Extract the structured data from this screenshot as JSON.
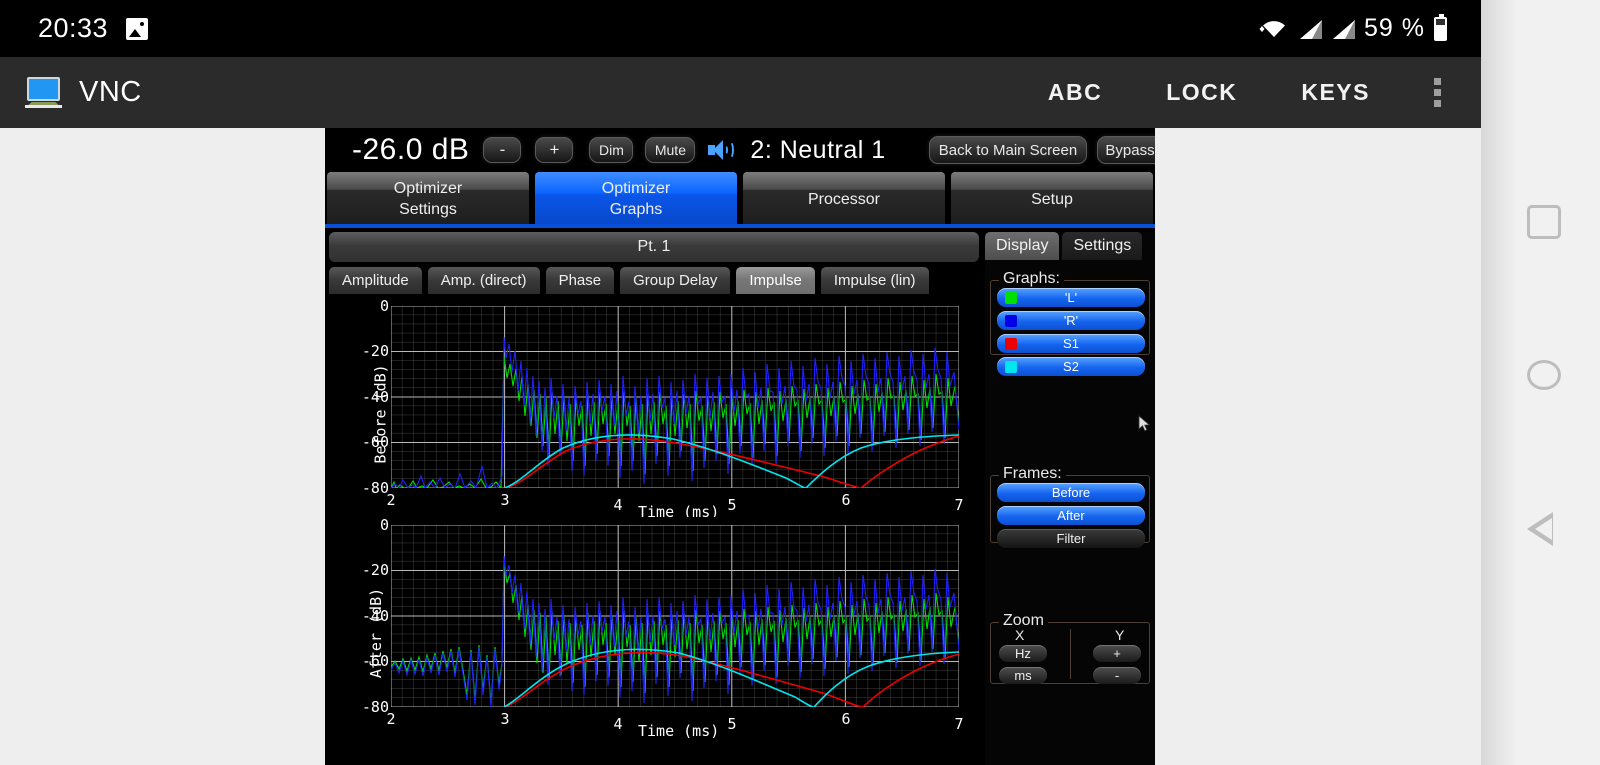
{
  "status_bar": {
    "clock": "20:33",
    "photo_icon": "image-icon",
    "wifi_icon": "wifi-icon",
    "signal_icon_1": "cell-signal-icon",
    "signal_icon_2": "cell-signal-icon",
    "battery_percent": "59 %",
    "battery_icon": "battery-icon"
  },
  "app_bar": {
    "icon": "vnc-monitor-icon",
    "title": "VNC",
    "buttons": [
      {
        "label": "ABC",
        "name": "abc-button"
      },
      {
        "label": "LOCK",
        "name": "lock-button"
      },
      {
        "label": "KEYS",
        "name": "keys-button"
      }
    ],
    "overflow_icon": "kebab-menu-icon"
  },
  "remote": {
    "control_strip": {
      "db_readout": "-26.0 dB",
      "minus": "-",
      "plus": "+",
      "dim": "Dim",
      "mute": "Mute",
      "speaker_icon": "speaker-volume-icon",
      "preset": "2: Neutral  1",
      "back_to_main": "Back to Main Screen",
      "bypass": "Bypass"
    },
    "main_tabs": [
      {
        "line1": "Optimizer",
        "line2": "Settings",
        "active": false
      },
      {
        "line1": "Optimizer",
        "line2": "Graphs",
        "active": true
      },
      {
        "line1": "Processor",
        "line2": "",
        "active": false
      },
      {
        "line1": "Setup",
        "line2": "",
        "active": false
      }
    ],
    "point_bar": "Pt. 1",
    "graph_tabs": [
      {
        "label": "Amplitude",
        "active": false
      },
      {
        "label": "Amp. (direct)",
        "active": false
      },
      {
        "label": "Phase",
        "active": false
      },
      {
        "label": "Group Delay",
        "active": false
      },
      {
        "label": "Impulse",
        "active": true
      },
      {
        "label": "Impulse (lin)",
        "active": false
      }
    ],
    "side_panel": {
      "tabs": [
        {
          "label": "Display",
          "active": true
        },
        {
          "label": "Settings",
          "active": false
        }
      ],
      "graphs_legend_title": "Graphs:",
      "graphs": [
        {
          "label": "'L'",
          "color": "#00e000",
          "on": true
        },
        {
          "label": "'R'",
          "color": "#0000e6",
          "on": true
        },
        {
          "label": "S1",
          "color": "#ee0000",
          "on": true
        },
        {
          "label": "S2",
          "color": "#00e6ee",
          "on": true
        }
      ],
      "frames_title": "Frames:",
      "frames": [
        {
          "label": "Before",
          "on": true
        },
        {
          "label": "After",
          "on": true
        },
        {
          "label": "Filter",
          "on": false
        }
      ],
      "zoom_title": "Zoom",
      "zoom_x_label": "X",
      "zoom_y_label": "Y",
      "zoom_x_buttons": [
        "Hz",
        "ms"
      ],
      "zoom_y_buttons": [
        "+",
        "-"
      ]
    },
    "cursor_icon": "mouse-pointer-icon"
  },
  "nav_bar": {
    "recents_icon": "recents-square-icon",
    "home_icon": "home-circle-icon",
    "back_icon": "back-triangle-icon"
  },
  "chart_data": [
    {
      "type": "line",
      "name": "before-impulse-plot",
      "title": "",
      "xlabel": "Time (ms)",
      "ylabel": "Before (dB)",
      "xlim": [
        2,
        7
      ],
      "ylim": [
        -80,
        0
      ],
      "xticks": [
        "2",
        "3",
        "4",
        "5",
        "6",
        "7"
      ],
      "yticks": [
        "0",
        "-20",
        "-40",
        "-60",
        "-80"
      ],
      "grid": true,
      "legend": [
        "'L'",
        "'R'",
        "S1",
        "S2"
      ],
      "legend_position": "right-panel",
      "series": [
        {
          "name": "'L'",
          "color": "#00e000",
          "description": "green noisy impulse response; floor at -80 dB before 3 ms, burst onset at 3.0 ms, decaying noise -30 to -55 dB across 3-7 ms"
        },
        {
          "name": "'R'",
          "color": "#2020ff",
          "description": "blue noisy impulse response; floor at -80 dB before 3 ms, peak -15 dB at 3.0 ms, noise -30 to -60 dB across 3-7 ms"
        },
        {
          "name": "S1",
          "color": "#ee0000",
          "description": "red smooth envelope; rises from -80 dB at 3.0 ms to -58 dB near 4.3 ms, slowly falls to -70 dB at 6.1 ms, dips to -80 dB at 6.4 ms then rises to -58 dB at 7 ms"
        },
        {
          "name": "S2",
          "color": "#00e6ee",
          "description": "cyan smooth envelope; rises from -80 dB at 3.0 ms to -57 dB near 4.2 ms, falls to -80 dB at 5.8 ms, recovers to -60 dB by 6.3 ms and holds to 7 ms"
        }
      ]
    },
    {
      "type": "line",
      "name": "after-impulse-plot",
      "title": "",
      "xlabel": "Time (ms)",
      "ylabel": "After (dB)",
      "xlim": [
        2,
        7
      ],
      "ylim": [
        -80,
        0
      ],
      "xticks": [
        "2",
        "3",
        "4",
        "5",
        "6",
        "7"
      ],
      "yticks": [
        "0",
        "-20",
        "-40",
        "-60",
        "-80"
      ],
      "grid": true,
      "legend": [
        "'L'",
        "'R'",
        "S1",
        "S2"
      ],
      "legend_position": "right-panel",
      "series": [
        {
          "name": "'L'",
          "color": "#00e000",
          "description": "green corrected impulse; pre-ringing around -62 dB from 2-2.9 ms, peak -14 dB at 3.0 ms, noise -35 to -60 dB for 3-7 ms"
        },
        {
          "name": "'R'",
          "color": "#2020ff",
          "description": "blue corrected impulse; pre-ringing around -62 dB from 2-2.9 ms, peak -14 dB at 3.0 ms, noise -35 to -60 dB for 3-7 ms"
        },
        {
          "name": "S1",
          "color": "#ee0000",
          "description": "red smooth envelope; -80 dB at 3.0 ms rising to -56 dB at 4.4 ms, gently falling to -72 dB at 6.2 ms, dip then rise to -58 dB at 7 ms"
        },
        {
          "name": "S2",
          "color": "#00e6ee",
          "description": "cyan smooth envelope; -80 dB at 3.0 ms rising to -55 dB at 4.3 ms, falling to -80 dB at 6.0 ms, recovering to -60 dB by 6.6 ms"
        }
      ]
    }
  ]
}
